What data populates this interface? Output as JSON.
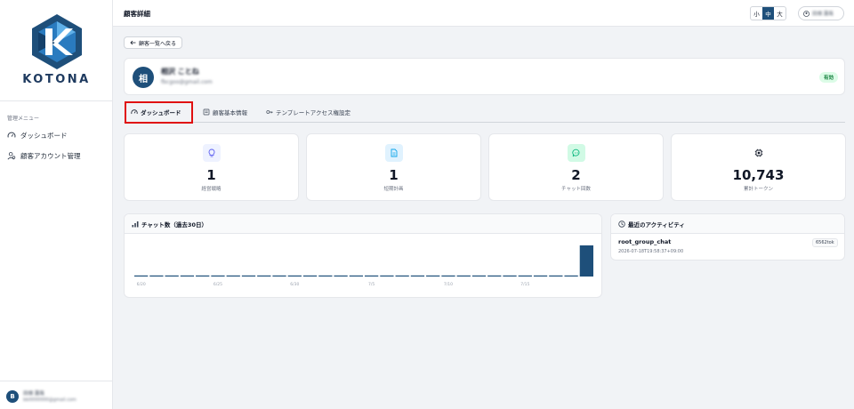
{
  "brand": {
    "name": "KOTONA",
    "primary_color": "#1e4f7a"
  },
  "sidebar": {
    "menu_heading": "管理メニュー",
    "items": [
      {
        "label": "ダッシュボード",
        "icon": "gauge-icon"
      },
      {
        "label": "顧客アカウント管理",
        "icon": "users-icon"
      }
    ],
    "footer": {
      "avatar": "B",
      "name": "田畑 蓮哉",
      "email": "bb0000000@gmail.com"
    }
  },
  "header": {
    "title": "顧客詳細",
    "font_sizes": [
      "小",
      "中",
      "大"
    ],
    "active_font_size": "中",
    "user_label": "田畑 蓮哉"
  },
  "back_button": {
    "label": "顧客一覧へ戻る"
  },
  "customer": {
    "avatar": "相",
    "name": "相沢 ことね",
    "email": "fbcgoo@gmail.com",
    "status": "有効",
    "status_color": "#15803d"
  },
  "tabs": [
    {
      "label": "ダッシュボード",
      "icon": "gauge-icon",
      "active": true
    },
    {
      "label": "顧客基本情報",
      "icon": "id-card-icon",
      "active": false
    },
    {
      "label": "テンプレートアクセス権設定",
      "icon": "key-icon",
      "active": false
    }
  ],
  "stats": [
    {
      "value": "1",
      "label": "経営戦略",
      "icon": "lightbulb-icon",
      "color": "#6366f1",
      "bg": "#eef2ff"
    },
    {
      "value": "1",
      "label": "短期計画",
      "icon": "document-icon",
      "color": "#0ea5e9",
      "bg": "#e0f2fe"
    },
    {
      "value": "2",
      "label": "チャット回数",
      "icon": "chat-icon",
      "color": "#10b981",
      "bg": "#d1fae5"
    },
    {
      "value": "10,743",
      "label": "累計トークン",
      "icon": "chip-icon",
      "color": "#111827",
      "bg": "transparent"
    }
  ],
  "chart_section": {
    "title": "チャット数（過去30日）"
  },
  "chart_data": {
    "type": "bar",
    "title": "チャット数（過去30日）",
    "categories": [
      "6/20",
      "6/21",
      "6/22",
      "6/23",
      "6/24",
      "6/25",
      "6/26",
      "6/27",
      "6/28",
      "6/29",
      "6/30",
      "7/1",
      "7/2",
      "7/3",
      "7/4",
      "7/5",
      "7/6",
      "7/7",
      "7/8",
      "7/9",
      "7/10",
      "7/11",
      "7/12",
      "7/13",
      "7/14",
      "7/15",
      "7/16",
      "7/17",
      "7/18",
      "7/19"
    ],
    "tick_labels": [
      "6/20",
      "6/25",
      "6/30",
      "7/5",
      "7/10",
      "7/15"
    ],
    "values": [
      0,
      0,
      0,
      0,
      0,
      0,
      0,
      0,
      0,
      0,
      0,
      0,
      0,
      0,
      0,
      0,
      0,
      0,
      0,
      0,
      0,
      0,
      0,
      0,
      0,
      0,
      0,
      0,
      0,
      2
    ],
    "ylim": [
      0,
      2
    ],
    "bar_color": "#1e4f7a"
  },
  "activity": {
    "title": "最近のアクティビティ",
    "items": [
      {
        "name": "root_group_chat",
        "timestamp": "2026-07-18T19:58:37+09:00",
        "tokens": "6562tok"
      }
    ]
  }
}
